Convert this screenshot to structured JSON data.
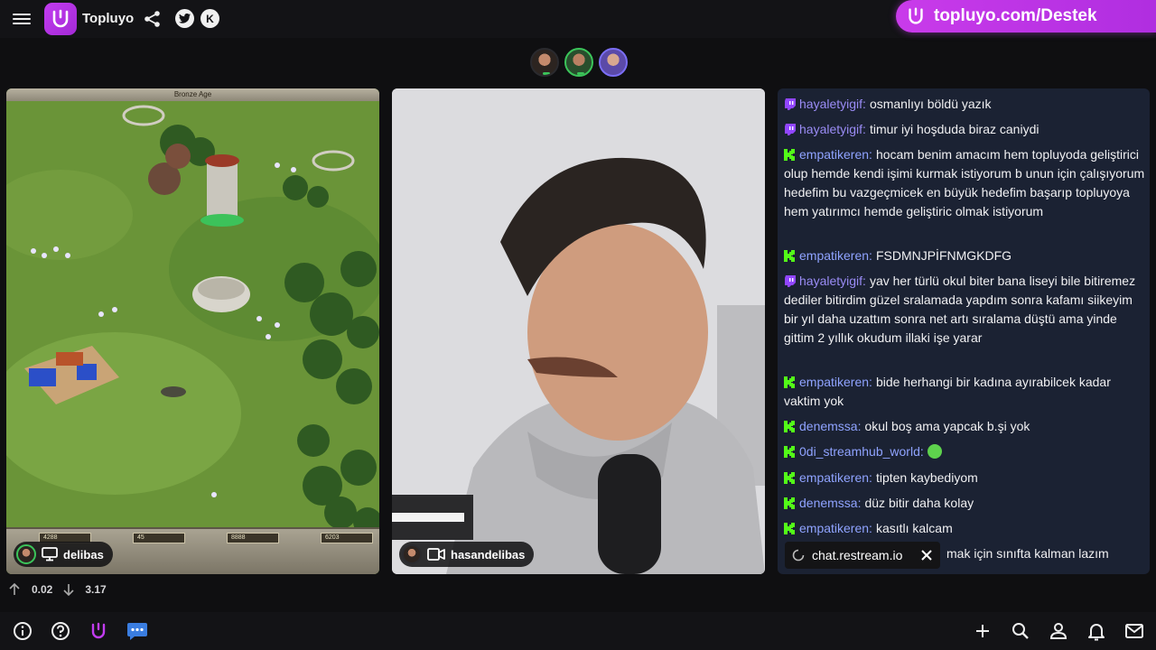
{
  "header": {
    "brand": "Topluyo",
    "promo_text": "topluyo.com/Destek",
    "kick_glyph": "K"
  },
  "game": {
    "top_label": "Bronze Age",
    "resources": [
      "4288",
      "45",
      "8888",
      "6203"
    ],
    "streamer_tag": "delibas"
  },
  "camera": {
    "streamer_tag": "hasandelibas"
  },
  "chat": {
    "messages": [
      {
        "platform": "twitch",
        "user": "hayaletyigif:",
        "text": "osmanlıyı böldü yazık"
      },
      {
        "platform": "twitch",
        "user": "hayaletyigif:",
        "text": "timur iyi hoşduda biraz caniydi"
      },
      {
        "platform": "kick",
        "user": "empatikeren:",
        "text": "hocam benim amacım hem topluyoda geliştirici olup hemde kendi işimi kurmak istiyorum b unun için çalışıyorum hedefim bu vazgeçmicek en büyük hedefim başarıp topluyoya hem yatırımcı hemde geliştiric olmak istiyorum"
      },
      {
        "platform": "kick",
        "user": "empatikeren:",
        "text": "FSDMNJPİFNMGKDFG"
      },
      {
        "platform": "twitch",
        "user": "hayaletyigif:",
        "text": "yav her türlü okul biter bana liseyi bile bitiremez dediler bitirdim güzel sralamada yapdım sonra kafamı siikeyim bir yıl daha uzattım sonra net artı sıralama düştü ama yinde gittim 2 yıllık okudum illaki işe yarar"
      },
      {
        "platform": "kick",
        "user": "empatikeren:",
        "text": "bide herhangi bir kadına ayırabilcek kadar vaktim yok"
      },
      {
        "platform": "kick",
        "user": "denemssa:",
        "text": "okul boş ama yapcak b.şi yok"
      },
      {
        "platform": "kick",
        "user": "0di_streamhub_world:",
        "text": ""
      },
      {
        "platform": "kick",
        "user": "empatikeren:",
        "text": "tipten kaybediyom"
      },
      {
        "platform": "kick",
        "user": "denemssa:",
        "text": "düz bitir daha kolay"
      },
      {
        "platform": "kick",
        "user": "empatikeren:",
        "text": "kasıtlı kalcam"
      }
    ],
    "partial_text": "mak için sınıfta kalman lazım",
    "restream_label": "chat.restream.io"
  },
  "stats": {
    "up_value": "0.02",
    "down_value": "3.17"
  },
  "colors": {
    "accent": "#c23cf0",
    "kick_green": "#53fc18",
    "twitch_purple": "#9a8cf5"
  }
}
